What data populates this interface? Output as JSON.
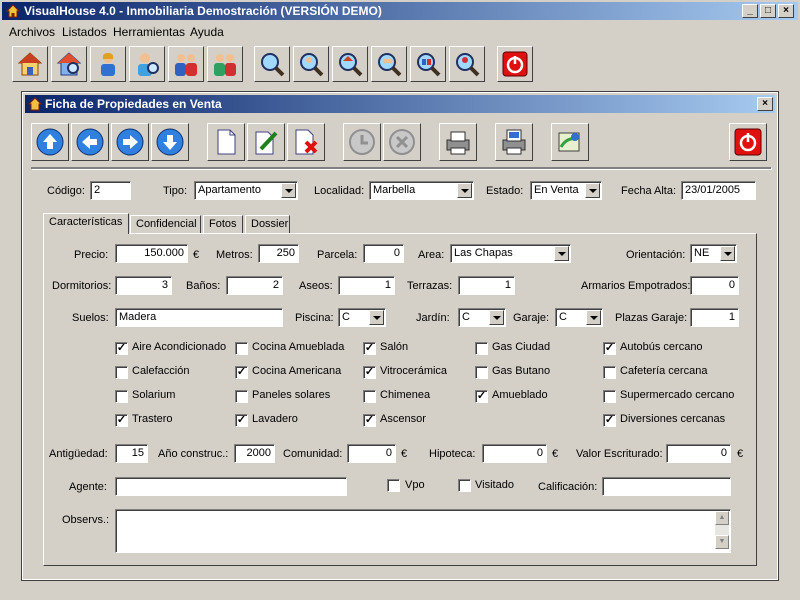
{
  "app": {
    "title": "VisualHouse 4.0 - Inmobiliaria Demostración (VERSIÓN DEMO)",
    "menu": [
      "Archivos",
      "Listados",
      "Herramientas",
      "Ayuda"
    ]
  },
  "main_toolbar": [
    "house-icon",
    "house-search-icon",
    "person-icon",
    "person-search-icon",
    "couple-icon",
    "couple-search-icon",
    "magnifier-icon",
    "magnifier-person-icon",
    "magnifier-house-icon",
    "magnifier-group-icon",
    "magnifier-couple-icon",
    "power-icon"
  ],
  "form": {
    "title": "Ficha de Propiedades en Venta",
    "toolbar": [
      "arrow-up-icon",
      "arrow-left-icon",
      "arrow-right-icon",
      "arrow-down-icon",
      "new-document-icon",
      "edit-document-icon",
      "delete-document-icon",
      "undo-icon",
      "cancel-icon",
      "print-icon",
      "print-list-icon",
      "map-icon",
      "power-icon"
    ],
    "header": {
      "codigo_label": "Código:",
      "codigo": "2",
      "tipo_label": "Tipo:",
      "tipo": "Apartamento",
      "localidad_label": "Localidad:",
      "localidad": "Marbella",
      "estado_label": "Estado:",
      "estado": "En Venta",
      "fecha_label": "Fecha Alta:",
      "fecha": "23/01/2005"
    },
    "tabs": [
      "Características",
      "Confidencial",
      "Fotos",
      "Dossier"
    ],
    "precio_label": "Precio:",
    "precio": "150.000",
    "euro": "€",
    "metros_label": "Metros:",
    "metros": "250",
    "parcela_label": "Parcela:",
    "parcela": "0",
    "area_label": "Area:",
    "area": "Las Chapas",
    "orientacion_label": "Orientación:",
    "orientacion": "NE",
    "dormitorios_label": "Dormitorios:",
    "dormitorios": "3",
    "banos_label": "Baños:",
    "banos": "2",
    "aseos_label": "Aseos:",
    "aseos": "1",
    "terrazas_label": "Terrazas:",
    "terrazas": "1",
    "armarios_label": "Armarios Empotrados:",
    "armarios": "0",
    "suelos_label": "Suelos:",
    "suelos": "Madera",
    "piscina_label": "Piscina:",
    "piscina": "C",
    "jardin_label": "Jardín:",
    "jardin": "C",
    "garaje_label": "Garaje:",
    "garaje": "C",
    "plazas_label": "Plazas Garaje:",
    "plazas": "1",
    "features": [
      {
        "label": "Aire Acondicionado",
        "checked": true
      },
      {
        "label": "Cocina Amueblada",
        "checked": false
      },
      {
        "label": "Salón",
        "checked": true
      },
      {
        "label": "Gas Ciudad",
        "checked": false
      },
      {
        "label": "Autobús cercano",
        "checked": true
      },
      {
        "label": "Calefacción",
        "checked": false
      },
      {
        "label": "Cocina Americana",
        "checked": true
      },
      {
        "label": "Vitrocerámica",
        "checked": true
      },
      {
        "label": "Gas Butano",
        "checked": false
      },
      {
        "label": "Cafetería cercana",
        "checked": false
      },
      {
        "label": "Solarium",
        "checked": false
      },
      {
        "label": "Paneles solares",
        "checked": false
      },
      {
        "label": "Chimenea",
        "checked": false
      },
      {
        "label": "Amueblado",
        "checked": true
      },
      {
        "label": "Supermercado cercano",
        "checked": false
      },
      {
        "label": "Trastero",
        "checked": true
      },
      {
        "label": "Lavadero",
        "checked": true
      },
      {
        "label": "Ascensor",
        "checked": true
      },
      {
        "label": "Diversiones cercanas",
        "checked": true
      }
    ],
    "antiguedad_label": "Antigüedad:",
    "antiguedad": "15",
    "anio_label": "Año construc.:",
    "anio": "2000",
    "comunidad_label": "Comunidad:",
    "comunidad": "0",
    "hipoteca_label": "Hipoteca:",
    "hipoteca": "0",
    "valor_label": "Valor Escriturado:",
    "valor": "0",
    "agente_label": "Agente:",
    "agente": "",
    "vpo_label": "Vpo",
    "vpo": false,
    "visitado_label": "Visitado",
    "visitado": false,
    "calificacion_label": "Calificación:",
    "calificacion": "",
    "observs_label": "Observs.:",
    "observs": ""
  }
}
